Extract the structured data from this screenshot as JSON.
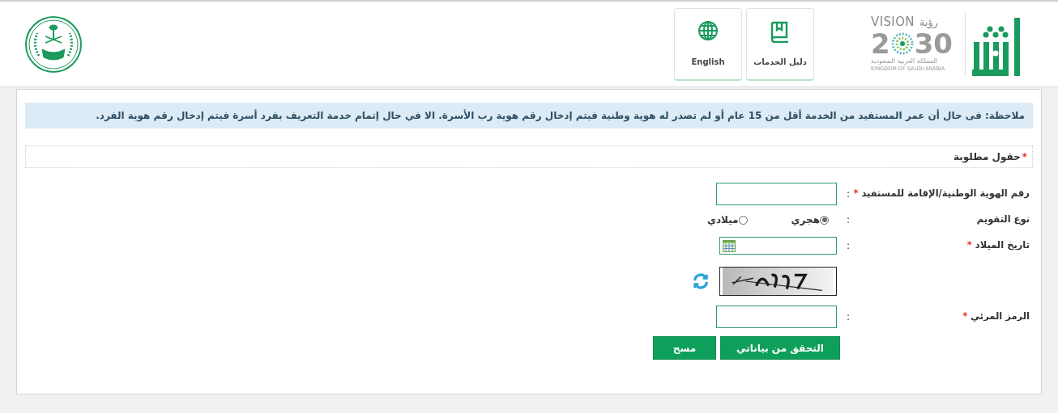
{
  "header": {
    "logo": {
      "vision": "VISION",
      "ruya": "رؤية",
      "year_start": "2",
      "year_end": "30",
      "kingdom_ar": "المملكة العربية السعودية",
      "kingdom_en": "KINGDOM OF SAUDI ARABIA"
    },
    "nav": [
      {
        "label": "دليل الخدمات",
        "kind": "book"
      },
      {
        "label": "English",
        "kind": "globe"
      }
    ]
  },
  "note": "ملاحظة: فى حال أن عمر المستفيد من الخدمة أقل من 15 عام أو لم تصدر له هوية وطنية فيتم إدخال رقم هوية رب الأسرة. الا في حال إتمام خدمة التعريف بفرد أسرة فيتم إدخال رقم هوية الفرد.",
  "required_legend": {
    "mark": "*",
    "label": "حقول مطلوبة"
  },
  "form": {
    "fields": [
      {
        "kind": "text",
        "label": "رقم الهوية الوطنية/الإقامة للمستفيد",
        "required_mark": "*",
        "separator": ":"
      },
      {
        "kind": "radio",
        "label": "نوع التقويم",
        "separator": ":",
        "options": [
          {
            "label": "هجري",
            "selected": true
          },
          {
            "label": "ميلادي",
            "selected": false
          }
        ]
      },
      {
        "kind": "date",
        "label": "تاريخ الميلاد",
        "required_mark": "*",
        "separator": ":"
      },
      {
        "kind": "captcha"
      },
      {
        "kind": "text",
        "label": "الرمز المرئي",
        "required_mark": "*",
        "separator": ":"
      }
    ],
    "buttons": [
      {
        "label": "التحقق من بياناتي",
        "kind": "primary"
      },
      {
        "label": "مسح",
        "kind": "secondary"
      }
    ]
  }
}
